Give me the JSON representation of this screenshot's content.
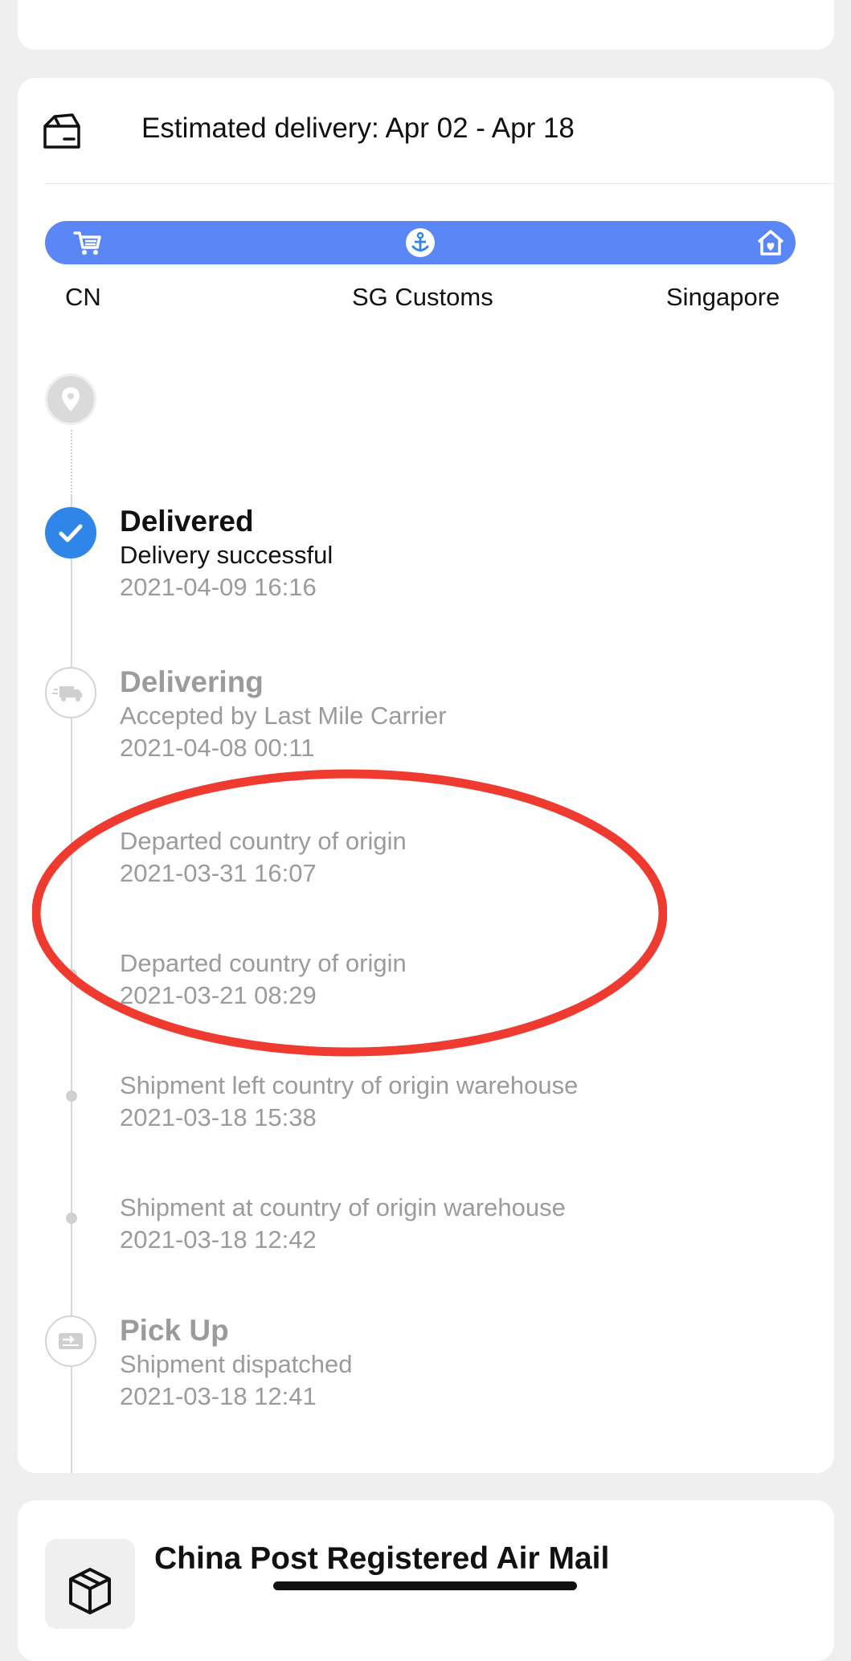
{
  "estimate": {
    "text": "Estimated delivery: Apr 02 - Apr 18",
    "icon": "package-box-icon"
  },
  "route": {
    "bar_color": "#5b86f5",
    "stops": [
      {
        "label": "CN",
        "icon": "cart-icon"
      },
      {
        "label": "SG Customs",
        "icon": "anchor-icon"
      },
      {
        "label": "Singapore",
        "icon": "home-icon"
      }
    ]
  },
  "timeline": {
    "destination_icon": "location-pin-icon",
    "events": [
      {
        "title": "Delivered",
        "desc": "Delivery successful",
        "time": "2021-04-09 16:16",
        "icon": "checkmark-icon"
      },
      {
        "title": "Delivering",
        "desc": "Accepted by Last Mile Carrier",
        "time": "2021-04-08 00:11",
        "icon": "truck-icon"
      },
      {
        "title": "",
        "desc": "Departed country of origin",
        "time": "2021-03-31 16:07"
      },
      {
        "title": "",
        "desc": "Departed country of origin",
        "time": "2021-03-21 08:29"
      },
      {
        "title": "",
        "desc": "Shipment left country of origin warehouse",
        "time": "2021-03-18 15:38"
      },
      {
        "title": "",
        "desc": "Shipment at country of origin warehouse",
        "time": "2021-03-18 12:42"
      },
      {
        "title": "Pick Up",
        "desc": "Shipment dispatched",
        "time": "2021-03-18 12:41",
        "icon": "dispatch-icon"
      }
    ]
  },
  "carrier": {
    "name": "China Post Registered Air Mail",
    "icon": "parcel-box-icon"
  },
  "colors": {
    "accent": "#2f86e8",
    "annotation": "#ef3b2f",
    "muted_text": "#9b9b9b"
  }
}
